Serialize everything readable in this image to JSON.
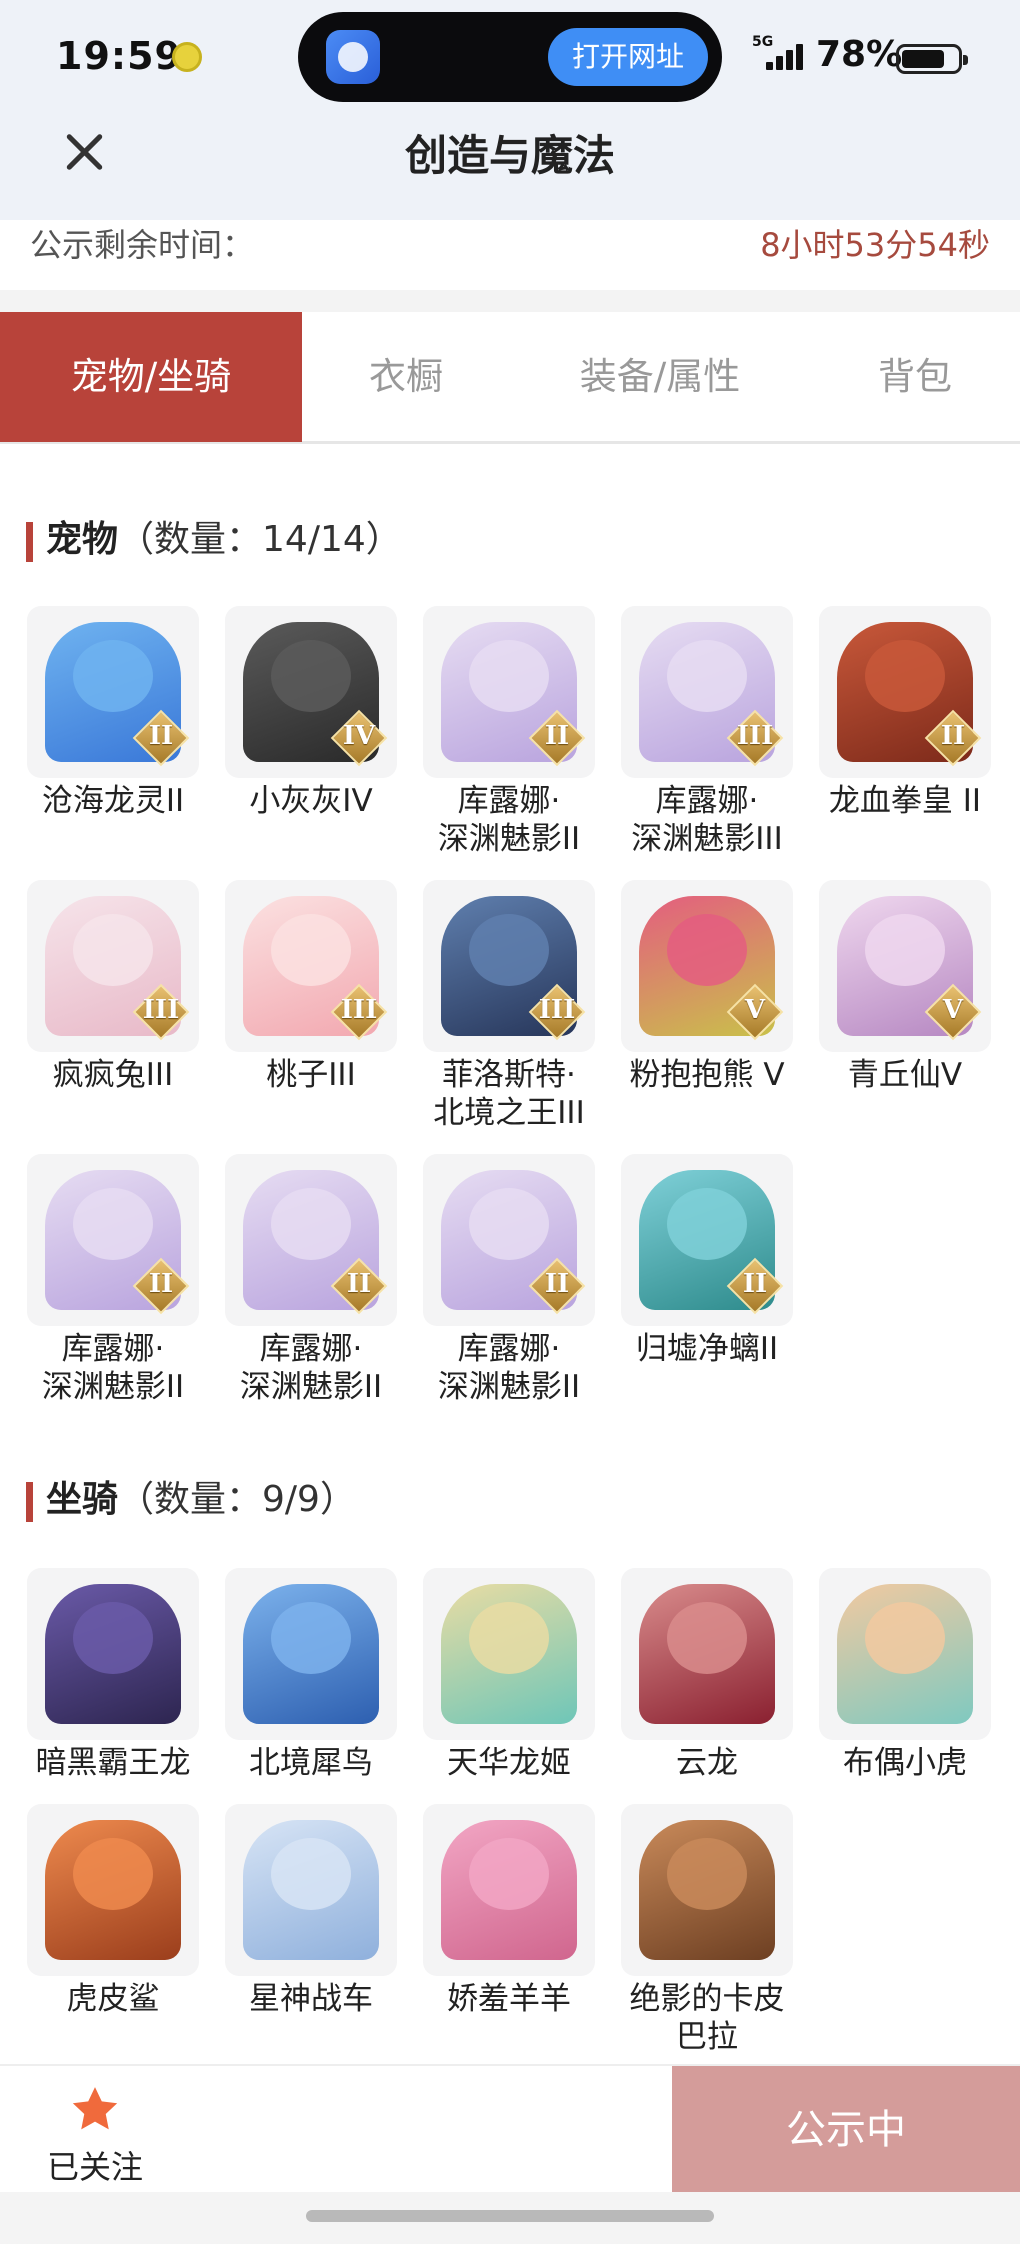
{
  "status_bar": {
    "time": "19:59",
    "island_button": "打开网址",
    "network": "5G",
    "battery": "78%",
    "battery_level": 0.78
  },
  "nav": {
    "title": "创造与魔法",
    "close_icon": "close-icon"
  },
  "countdown": {
    "label": "公示剩余时间：",
    "value": "8小时53分54秒"
  },
  "tabs": [
    {
      "label": "宠物/坐骑",
      "active": true
    },
    {
      "label": "衣橱",
      "active": false
    },
    {
      "label": "装备/属性",
      "active": false
    },
    {
      "label": "背包",
      "active": false
    }
  ],
  "pets": {
    "title": "宠物",
    "count": "（数量：14/14）",
    "items": [
      {
        "name": "沧海龙灵II",
        "grade": "II",
        "colors": [
          "#6fb3f0",
          "#3a78d8"
        ]
      },
      {
        "name": "小灰灰IV",
        "grade": "IV",
        "colors": [
          "#5a5a5a",
          "#2a2a2a"
        ]
      },
      {
        "name": "库露娜·深渊魅影II",
        "grade": "II",
        "colors": [
          "#e6dcf2",
          "#b9a4de"
        ]
      },
      {
        "name": "库露娜·深渊魅影III",
        "grade": "III",
        "colors": [
          "#e6dcf2",
          "#b9a4de"
        ]
      },
      {
        "name": "龙血拳皇 II",
        "grade": "II",
        "colors": [
          "#c8583a",
          "#7d2a1a"
        ]
      },
      {
        "name": "疯疯兔III",
        "grade": "III",
        "colors": [
          "#f6e4ea",
          "#e8b9c8"
        ]
      },
      {
        "name": "桃子III",
        "grade": "III",
        "colors": [
          "#fbe1e1",
          "#f2a8b0"
        ]
      },
      {
        "name": "菲洛斯特·北境之王III",
        "grade": "III",
        "colors": [
          "#5f7fae",
          "#27365a"
        ]
      },
      {
        "name": "粉抱抱熊 V",
        "grade": "V",
        "colors": [
          "#e45d80",
          "#c9c14a"
        ]
      },
      {
        "name": "青丘仙V",
        "grade": "V",
        "colors": [
          "#efd7ee",
          "#b688c2"
        ]
      },
      {
        "name": "库露娜·深渊魅影II",
        "grade": "II",
        "colors": [
          "#e6dcf2",
          "#b9a4de"
        ]
      },
      {
        "name": "库露娜·深渊魅影II",
        "grade": "II",
        "colors": [
          "#e6dcf2",
          "#b9a4de"
        ]
      },
      {
        "name": "库露娜·深渊魅影II",
        "grade": "II",
        "colors": [
          "#e6dcf2",
          "#b9a4de"
        ]
      },
      {
        "name": "归墟净螭II",
        "grade": "II",
        "colors": [
          "#7fd0d8",
          "#2e8b8c"
        ]
      }
    ]
  },
  "mounts": {
    "title": "坐骑",
    "count": "（数量：9/9）",
    "items": [
      {
        "name": "暗黑霸王龙",
        "colors": [
          "#6a5aa8",
          "#2d2550"
        ]
      },
      {
        "name": "北境犀鸟",
        "colors": [
          "#7cb2ec",
          "#2d5fb0"
        ]
      },
      {
        "name": "天华龙姬",
        "colors": [
          "#e9dca3",
          "#6ec6b8"
        ]
      },
      {
        "name": "云龙",
        "colors": [
          "#d98c8c",
          "#8a2030"
        ]
      },
      {
        "name": "布偶小虎",
        "colors": [
          "#f2c9a0",
          "#7fc9c0"
        ]
      },
      {
        "name": "虎皮鲨",
        "colors": [
          "#ee8a4e",
          "#9b3e1c"
        ]
      },
      {
        "name": "星神战车",
        "colors": [
          "#d7e4f5",
          "#8fb0dc"
        ]
      },
      {
        "name": "娇羞羊羊",
        "colors": [
          "#f2a6c4",
          "#d0668e"
        ]
      },
      {
        "name": "绝影的卡皮巴拉",
        "colors": [
          "#c98a5a",
          "#6d3f22"
        ]
      }
    ]
  },
  "bottom": {
    "follow_label": "已关注",
    "follow_icon": "star-icon",
    "status_button": "公示中"
  },
  "colors": {
    "accent": "#b8433a",
    "countdown": "#a64a3e",
    "status_button": "#d49c9a",
    "star": "#f06a3c"
  }
}
